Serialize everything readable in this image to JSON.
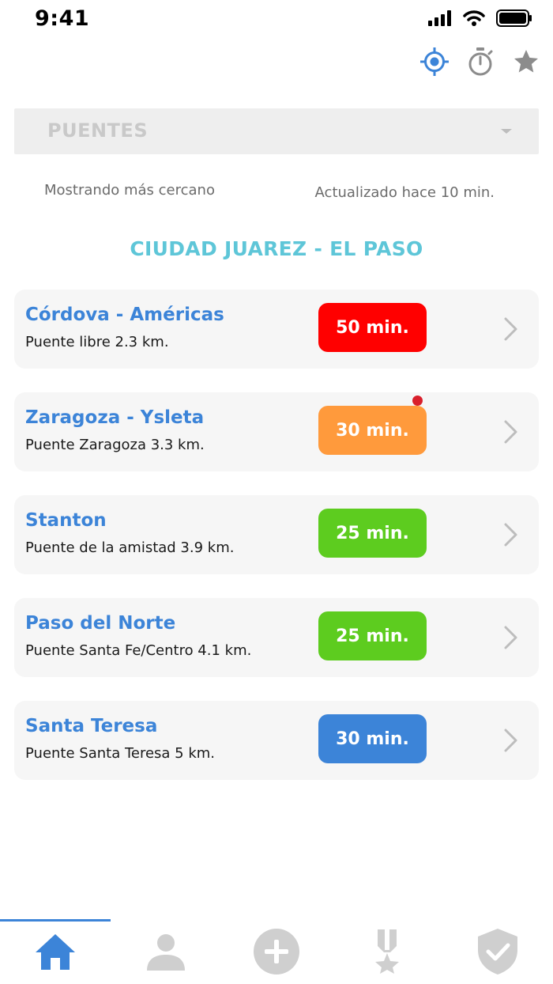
{
  "status_bar": {
    "time": "9:41"
  },
  "top_actions": [
    {
      "name": "locate-icon",
      "color": "#3c84d8"
    },
    {
      "name": "stopwatch-icon",
      "color": "#8c8c8c"
    },
    {
      "name": "star-icon",
      "color": "#8c8c8c"
    }
  ],
  "dropdown": {
    "selected": "PUENTES"
  },
  "info": {
    "showing": "Mostrando más cercano",
    "updated": "Actualizado hace 10 min."
  },
  "section": {
    "title": "CIUDAD JUAREZ - EL PASO"
  },
  "bridges": [
    {
      "name": "Córdova - Américas",
      "subtitle": "Puente libre 2.3 km.",
      "wait": "50 min.",
      "color": "#ff0000",
      "notification": false
    },
    {
      "name": "Zaragoza - Ysleta",
      "subtitle": "Puente Zaragoza  3.3 km.",
      "wait": "30 min.",
      "color": "#ff9a3c",
      "notification": true
    },
    {
      "name": "Stanton",
      "subtitle": "Puente de la amistad 3.9 km.",
      "wait": "25 min.",
      "color": "#5dcc1f",
      "notification": false
    },
    {
      "name": "Paso del Norte",
      "subtitle": "Puente Santa Fe/Centro 4.1 km.",
      "wait": "25 min.",
      "color": "#5dcc1f",
      "notification": false
    },
    {
      "name": "Santa Teresa",
      "subtitle": "Puente Santa Teresa  5 km.",
      "wait": "30 min.",
      "color": "#3c84d8",
      "notification": false
    }
  ],
  "bottom_nav": [
    {
      "name": "home-icon",
      "active": true,
      "color": "#3c84d8"
    },
    {
      "name": "profile-icon",
      "active": false,
      "color": "#cfcfcf"
    },
    {
      "name": "add-icon",
      "active": false,
      "color": "#cfcfcf"
    },
    {
      "name": "medal-icon",
      "active": false,
      "color": "#cfcfcf"
    },
    {
      "name": "shield-check-icon",
      "active": false,
      "color": "#cfcfcf"
    }
  ]
}
